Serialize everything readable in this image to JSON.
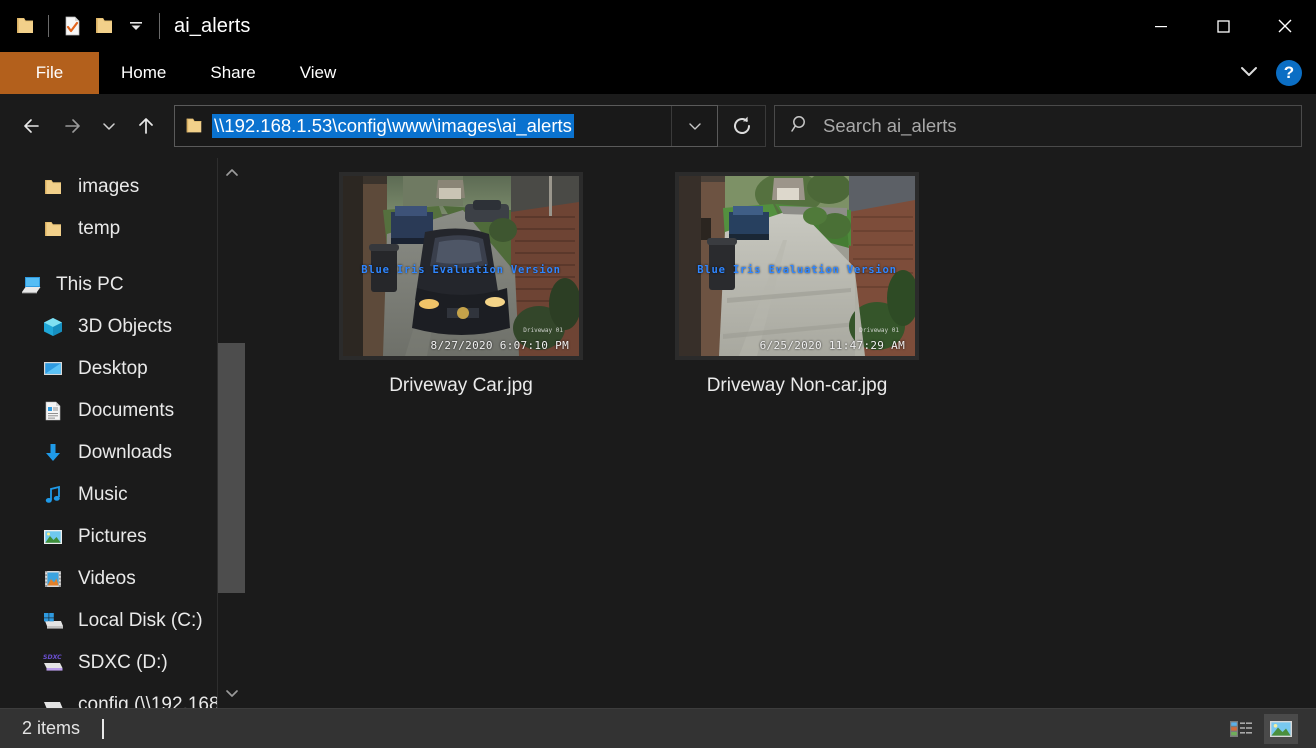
{
  "window": {
    "title": "ai_alerts",
    "quick_access": [
      {
        "name": "app-folder-icon",
        "label": "File Explorer"
      },
      {
        "name": "properties-icon",
        "label": "Properties"
      },
      {
        "name": "new-folder-icon",
        "label": "New folder"
      },
      {
        "name": "customize-qat-icon",
        "label": "Customize Quick Access Toolbar"
      }
    ],
    "controls": {
      "minimize": "Minimize",
      "maximize": "Maximize",
      "close": "Close"
    }
  },
  "ribbon": {
    "tabs": [
      {
        "label": "File",
        "active": true
      },
      {
        "label": "Home",
        "active": false
      },
      {
        "label": "Share",
        "active": false
      },
      {
        "label": "View",
        "active": false
      }
    ],
    "expand_label": "Expand the Ribbon",
    "help_label": "?"
  },
  "navbar": {
    "back_label": "Back",
    "forward_label": "Forward",
    "recent_label": "Recent locations",
    "up_label": "Up",
    "address_value": "\\\\192.168.1.53\\config\\www\\images\\ai_alerts",
    "address_dropdown_label": "Previous locations",
    "refresh_label": "Refresh",
    "search_placeholder": "Search ai_alerts"
  },
  "sidebar": {
    "items": [
      {
        "label": "images",
        "icon": "folder-icon",
        "indent": 2
      },
      {
        "label": "temp",
        "icon": "folder-icon",
        "indent": 2
      },
      {
        "label": "This PC",
        "icon": "this-pc-icon",
        "indent": 1
      },
      {
        "label": "3D Objects",
        "icon": "3d-objects-icon",
        "indent": 2
      },
      {
        "label": "Desktop",
        "icon": "desktop-icon",
        "indent": 2
      },
      {
        "label": "Documents",
        "icon": "documents-icon",
        "indent": 2
      },
      {
        "label": "Downloads",
        "icon": "downloads-icon",
        "indent": 2
      },
      {
        "label": "Music",
        "icon": "music-icon",
        "indent": 2
      },
      {
        "label": "Pictures",
        "icon": "pictures-icon",
        "indent": 2
      },
      {
        "label": "Videos",
        "icon": "videos-icon",
        "indent": 2
      },
      {
        "label": "Local Disk (C:)",
        "icon": "local-disk-icon",
        "indent": 2
      },
      {
        "label": "SDXC (D:)",
        "icon": "sdxc-drive-icon",
        "indent": 2
      },
      {
        "label": "config (\\\\192.168",
        "icon": "network-drive-icon",
        "indent": 2
      }
    ],
    "scroll_up_label": "Scroll up",
    "scroll_down_label": "Scroll down"
  },
  "files": [
    {
      "name": "Driveway Car.jpg",
      "watermark": "Blue Iris Evaluation Version",
      "camera": "Driveway 01",
      "timestamp": "8/27/2020 6:07:10 PM"
    },
    {
      "name": "Driveway Non-car.jpg",
      "watermark": "Blue Iris Evaluation Version",
      "camera": "Driveway 01",
      "timestamp": "6/25/2020 11:47:29 AM"
    }
  ],
  "statusbar": {
    "item_count": "2 items",
    "details_view_label": "Details view",
    "large_icons_view_label": "Large icons view"
  },
  "colors": {
    "file_tab": "#b3601c",
    "selection_blue": "#0a72cf",
    "help_blue": "#0b6ec4",
    "window_bg": "#1b1b1b",
    "titlebar_bg": "#000000",
    "statusbar_bg": "#333333",
    "watermark_blue": "#2f86ff"
  }
}
